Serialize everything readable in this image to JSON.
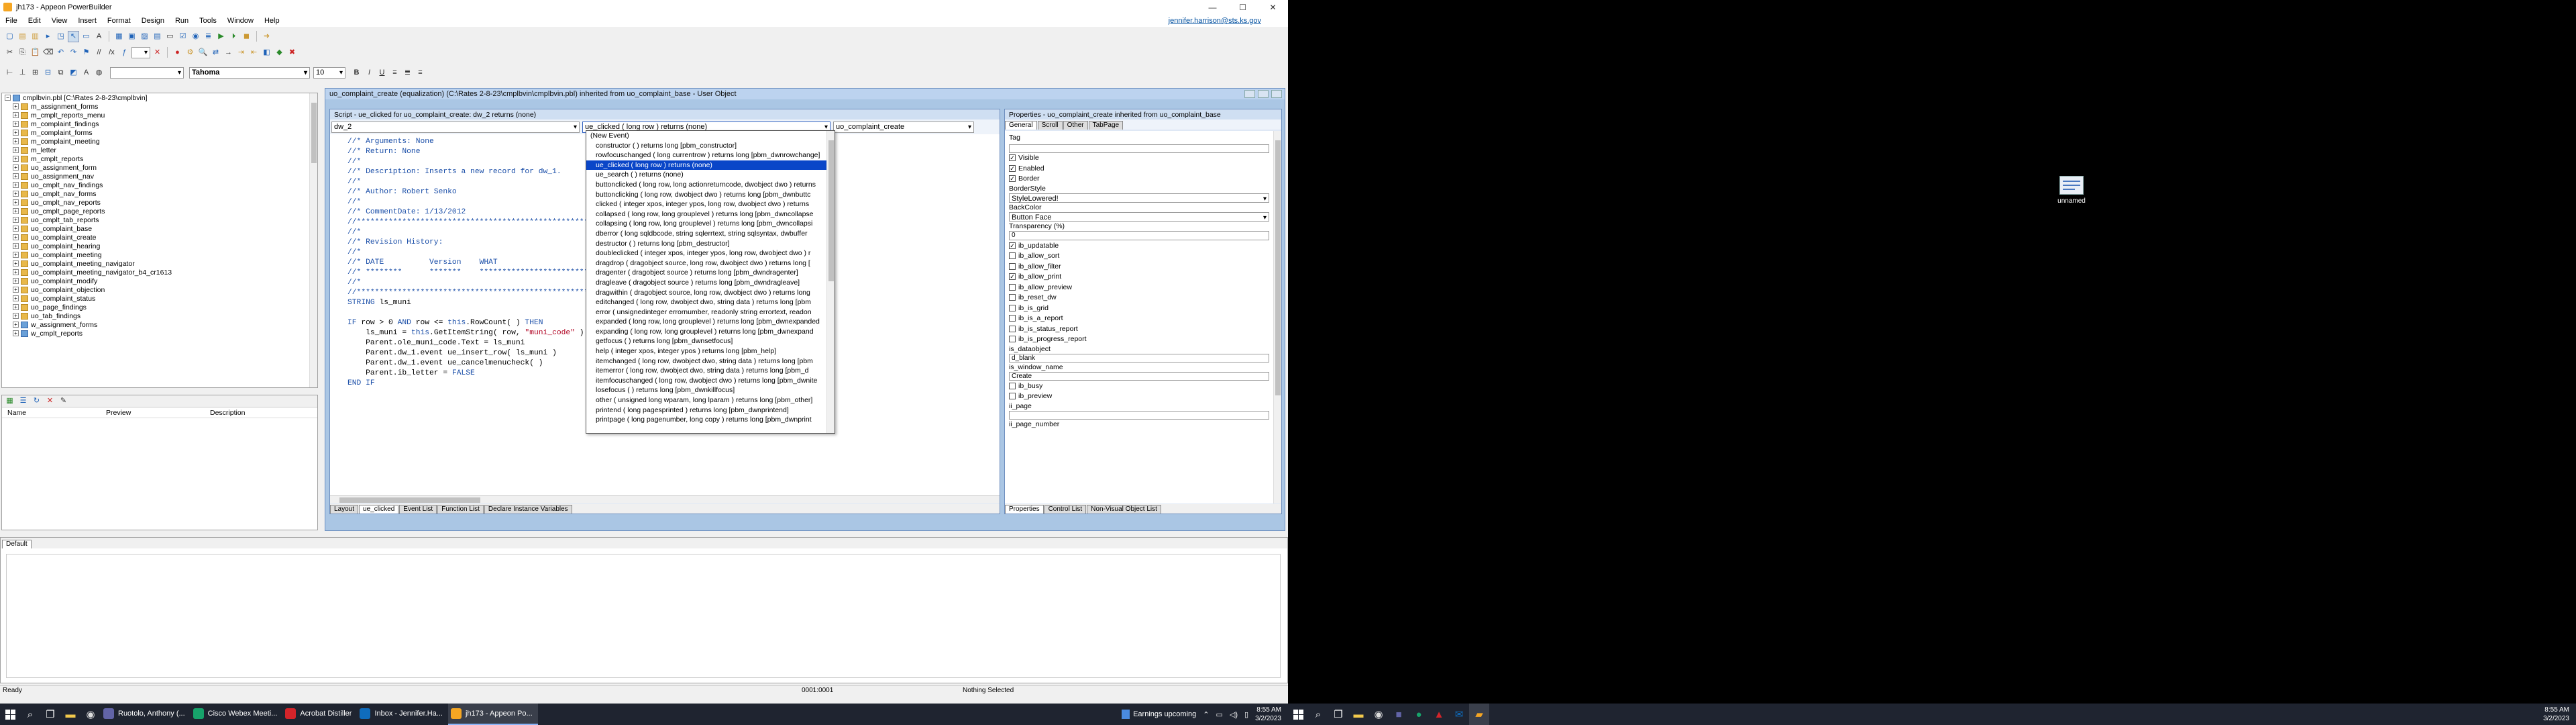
{
  "window": {
    "title": "jh173 - Appeon PowerBuilder",
    "user_link": "jennifer.harrison@sts.ks.gov"
  },
  "menu": [
    "File",
    "Edit",
    "View",
    "Insert",
    "Format",
    "Design",
    "Run",
    "Tools",
    "Window",
    "Help"
  ],
  "font_toolbar": {
    "font": "Tahoma",
    "size": "10",
    "bold": "B",
    "italic": "I",
    "underline": "U"
  },
  "tree": {
    "root": "cmplbvin.pbl [C:\\Rates 2-8-23\\cmplbvin]",
    "items": [
      "m_assignment_forms",
      "m_cmplt_reports_menu",
      "m_complaint_findings",
      "m_complaint_forms",
      "m_complaint_meeting",
      "m_letter",
      "m_cmplt_reports",
      "uo_assignment_form",
      "uo_assignment_nav",
      "uo_cmplt_nav_findings",
      "uo_cmplt_nav_forms",
      "uo_cmplt_nav_reports",
      "uo_cmplt_page_reports",
      "uo_cmplt_tab_reports",
      "uo_complaint_base",
      "uo_complaint_create",
      "uo_complaint_hearing",
      "uo_complaint_meeting",
      "uo_complaint_meeting_navigator",
      "uo_complaint_meeting_navigator_b4_cr1613",
      "uo_complaint_modify",
      "uo_complaint_objection",
      "uo_complaint_status",
      "uo_page_findings",
      "uo_tab_findings",
      "w_assignment_forms",
      "w_cmplt_reports"
    ]
  },
  "lower_left": {
    "columns": [
      "Name",
      "Preview",
      "Description"
    ]
  },
  "editor": {
    "title": "uo_complaint_create (equalization) (C:\\Rates 2-8-23\\cmplbvin\\cmplbvin.pbl) inherited from uo_complaint_base - User Object",
    "script_title": "Script - ue_clicked for uo_complaint_create: dw_2 returns (none)",
    "object_combo": "dw_2",
    "event_combo": "ue_clicked ( long row ) returns (none)",
    "ancestor_combo": "uo_complaint_create",
    "code_lines": [
      {
        "t": "//* Arguments: None",
        "c": "cm"
      },
      {
        "t": "//* Return: None",
        "c": "cm"
      },
      {
        "t": "//*",
        "c": "cm"
      },
      {
        "t": "//* Description: Inserts a new record for dw_1.",
        "c": "cm"
      },
      {
        "t": "//*",
        "c": "cm"
      },
      {
        "t": "//* Author: Robert Senko",
        "c": "cm"
      },
      {
        "t": "//*",
        "c": "cm"
      },
      {
        "t": "//* CommentDate: 1/13/2012",
        "c": "cm"
      },
      {
        "t": "//*********************************************************************************************",
        "c": "cm"
      },
      {
        "t": "//*",
        "c": "cm"
      },
      {
        "t": "//* Revision History:",
        "c": "cm"
      },
      {
        "t": "//*",
        "c": "cm"
      },
      {
        "t": "//* DATE          Version    WHAT                                                            WHO",
        "c": "cm"
      },
      {
        "t": "//* ********      *******    *****************************************************************",
        "c": "cm"
      },
      {
        "t": "//*",
        "c": "cm"
      },
      {
        "t": "//*********************************************************************************************",
        "c": "cm"
      },
      {
        "t": "STRING ls_muni",
        "c": "mix"
      },
      {
        "t": "",
        "c": ""
      },
      {
        "t": "IF row > 0 AND row <= this.RowCount( ) THEN",
        "c": "mix"
      },
      {
        "t": "    ls_muni = this.GetItemString( row, \"muni_code\" )",
        "c": "mix"
      },
      {
        "t": "    Parent.ole_muni_code.Text = ls_muni",
        "c": ""
      },
      {
        "t": "    Parent.dw_1.event ue_insert_row( ls_muni )",
        "c": ""
      },
      {
        "t": "    Parent.dw_1.event ue_cancelmenucheck( )",
        "c": ""
      },
      {
        "t": "    Parent.ib_letter = FALSE",
        "c": "mix"
      },
      {
        "t": "END IF",
        "c": "mix"
      }
    ],
    "dropdown_items": [
      "(New Event)",
      "constructor ( ) returns long [pbm_constructor]",
      "rowfocuschanged ( long currentrow ) returns long [pbm_dwnrowchange]",
      "ue_clicked ( long row ) returns (none)",
      "ue_search ( ) returns (none)",
      "buttonclicked ( long row, long actionreturncode, dwobject dwo ) returns",
      "buttonclicking ( long row, dwobject dwo ) returns long [pbm_dwnbuttc",
      "clicked ( integer xpos, integer ypos, long row, dwobject dwo ) returns",
      "collapsed ( long row, long grouplevel ) returns long [pbm_dwncollapse",
      "collapsing ( long row, long grouplevel ) returns long [pbm_dwncollapsi",
      "dberror ( long sqldbcode, string sqlerrtext, string sqlsyntax, dwbuffer",
      "destructor ( ) returns long [pbm_destructor]",
      "doubleclicked ( integer xpos, integer ypos, long row, dwobject dwo ) r",
      "dragdrop ( dragobject source, long row, dwobject dwo ) returns long [",
      "dragenter ( dragobject source ) returns long [pbm_dwndragenter]",
      "dragleave ( dragobject source ) returns long [pbm_dwndragleave]",
      "dragwithin ( dragobject source, long row, dwobject dwo ) returns long",
      "editchanged ( long row, dwobject dwo, string data ) returns long [pbm",
      "error ( unsignedinteger errornumber, readonly string errortext, readon",
      "expanded ( long row, long grouplevel ) returns long [pbm_dwnexpanded",
      "expanding ( long row, long grouplevel ) returns long [pbm_dwnexpand",
      "getfocus ( ) returns long [pbm_dwnsetfocus]",
      "help ( integer xpos, integer ypos ) returns long [pbm_help]",
      "itemchanged ( long row, dwobject dwo, string data ) returns long [pbm",
      "itemerror ( long row, dwobject dwo, string data ) returns long [pbm_d",
      "itemfocuschanged ( long row, dwobject dwo ) returns long [pbm_dwnite",
      "losefocus ( ) returns long [pbm_dwnkillfocus]",
      "other ( unsigned long wparam, long lparam ) returns long [pbm_other]",
      "printend ( long pagesprinted ) returns long [pbm_dwnprintend]",
      "printpage ( long pagenumber, long copy ) returns long [pbm_dwnprint"
    ],
    "bottom_tabs": [
      "Layout",
      "ue_clicked",
      "Event List",
      "Function List",
      "Declare Instance Variables"
    ]
  },
  "properties": {
    "title": "Properties - uo_complaint_create  inherited  from  uo_complaint_base",
    "tabs": [
      "General",
      "Scroll",
      "Other",
      "TabPage"
    ],
    "tag_label": "Tag",
    "checks": [
      {
        "label": "Visible",
        "on": true
      },
      {
        "label": "Enabled",
        "on": true
      },
      {
        "label": "Border",
        "on": true
      }
    ],
    "border_style_label": "BorderStyle",
    "border_style_value": "StyleLowered!",
    "backcolor_label": "BackColor",
    "backcolor_value": "Button Face",
    "transparency_label": "Transparency (%)",
    "transparency_value": "0",
    "flags": [
      {
        "label": "ib_updatable",
        "on": true
      },
      {
        "label": "ib_allow_sort",
        "on": false
      },
      {
        "label": "ib_allow_filter",
        "on": false
      },
      {
        "label": "ib_allow_print",
        "on": true
      },
      {
        "label": "ib_allow_preview",
        "on": false
      },
      {
        "label": "ib_reset_dw",
        "on": false
      },
      {
        "label": "ib_is_grid",
        "on": false
      },
      {
        "label": "ib_is_a_report",
        "on": false
      },
      {
        "label": "ib_is_status_report",
        "on": false
      },
      {
        "label": "ib_is_progress_report",
        "on": false
      }
    ],
    "is_dataobject_label": "is_dataobject",
    "is_dataobject_value": "d_blank",
    "is_window_name_label": "is_window_name",
    "is_window_name_value": "Create",
    "flags2": [
      {
        "label": "ib_busy",
        "on": false
      },
      {
        "label": "ib_preview",
        "on": false
      }
    ],
    "ii_page_label": "ii_page",
    "ii_page_number_label": "ii_page_number",
    "bottom_tabs": [
      "Properties",
      "Control List",
      "Non-Visual Object List"
    ]
  },
  "output": {
    "tab": "Default"
  },
  "status": {
    "left": "Ready",
    "pos": "0001:0001",
    "sel": "Nothing Selected"
  },
  "taskbar": {
    "apps": [
      {
        "label": "Ruotolo, Anthony (...",
        "color": "#6264a7"
      },
      {
        "label": "Cisco Webex Meeti...",
        "color": "#17a36b"
      },
      {
        "label": "Acrobat Distiller",
        "color": "#d4242a"
      },
      {
        "label": "Inbox - Jennifer.Ha...",
        "color": "#0f6cbd"
      },
      {
        "label": "jh173 - Appeon Po...",
        "color": "#f5a623"
      }
    ],
    "weather": "Earnings upcoming",
    "time": "8:55 AM",
    "date": "3/2/2023"
  },
  "desktop": {
    "icon_label": "unnamed"
  }
}
